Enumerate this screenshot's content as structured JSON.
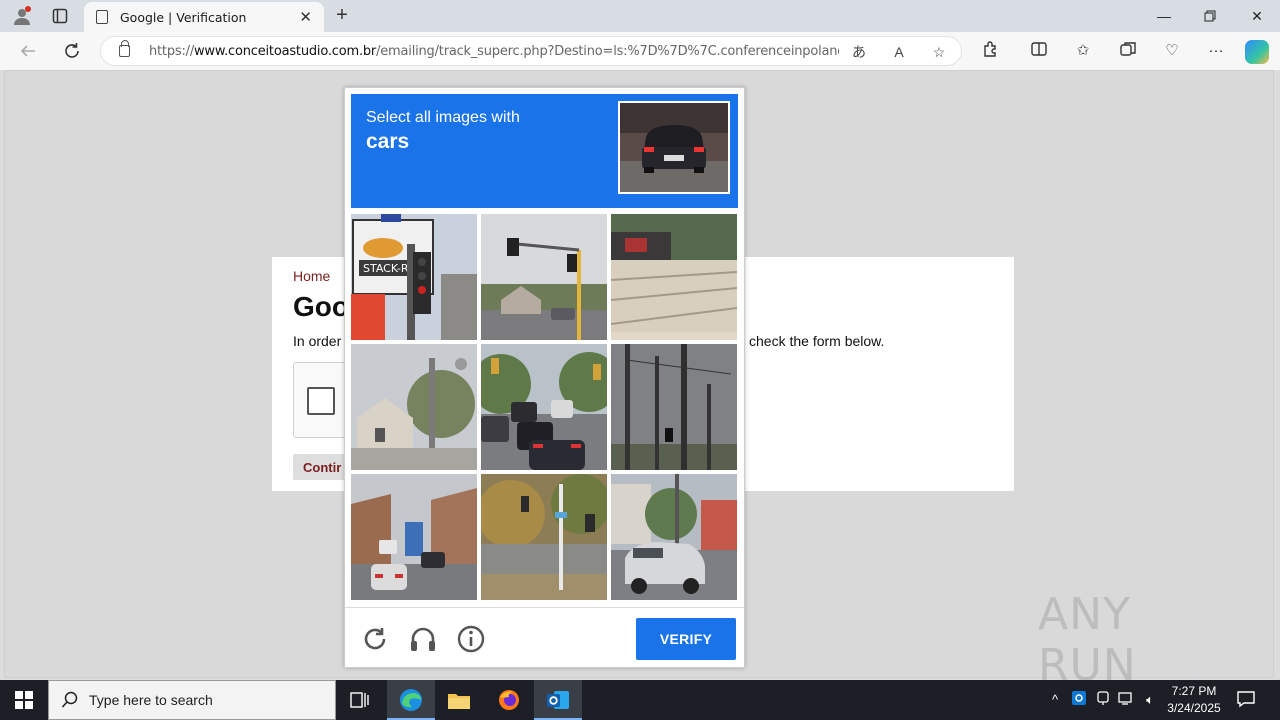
{
  "browser": {
    "tab_title": "Google | Verification",
    "url_prefix": "https://",
    "url_domain": "www.conceitoastudio.com.br",
    "url_path": "/emailing/track_superc.php?Destino=ls:%7D%7D%7C.conferenceinpoland.x..."
  },
  "page": {
    "home_link": "Home",
    "title_fragment": "Goo",
    "intro_fragment": "In order",
    "intro_tail": "check the form below.",
    "continue_label": "Contir"
  },
  "captcha": {
    "instruction": "Select all images with",
    "target_object": "cars",
    "verify_label": "VERIFY",
    "accent_color": "#1a73e8"
  },
  "watermark": {
    "text": "ANY RUN"
  },
  "taskbar": {
    "search_placeholder": "Type here to search",
    "time": "7:27 PM",
    "date": "3/24/2025"
  }
}
